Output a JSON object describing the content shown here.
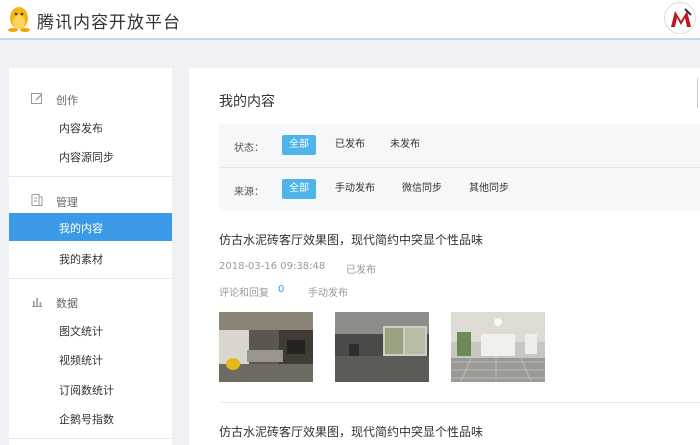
{
  "header": {
    "brand": "腾讯内容开放平台"
  },
  "sidebar": {
    "groups": [
      {
        "title": "创作",
        "items": [
          {
            "label": "内容发布"
          },
          {
            "label": "内容源同步"
          }
        ]
      },
      {
        "title": "管理",
        "items": [
          {
            "label": "我的内容",
            "active": true
          },
          {
            "label": "我的素材"
          }
        ]
      },
      {
        "title": "数据",
        "items": [
          {
            "label": "图文统计"
          },
          {
            "label": "视频统计"
          },
          {
            "label": "订阅数统计"
          },
          {
            "label": "企鹅号指数"
          }
        ]
      }
    ]
  },
  "main": {
    "title": "我的内容",
    "filters": {
      "status": {
        "label": "状态：",
        "options": [
          "全部",
          "已发布",
          "未发布"
        ],
        "selected": "全部"
      },
      "source": {
        "label": "来源：",
        "options": [
          "全部",
          "手动发布",
          "微信同步",
          "其他同步"
        ],
        "selected": "全部"
      }
    },
    "articles": [
      {
        "title": "仿古水泥砖客厅效果图，现代简约中突显个性品味",
        "time": "2018-03-16 09:38:48",
        "status": "已发布",
        "comments_label": "评论和回复",
        "comments_count": "0",
        "source": "手动发布"
      },
      {
        "title": "仿古水泥砖客厅效果图，现代简约中突显个性品味"
      }
    ]
  },
  "colors": {
    "accent": "#3a9ae8",
    "chip_active": "#4fb4ea",
    "page_bg": "#eff1f5"
  }
}
